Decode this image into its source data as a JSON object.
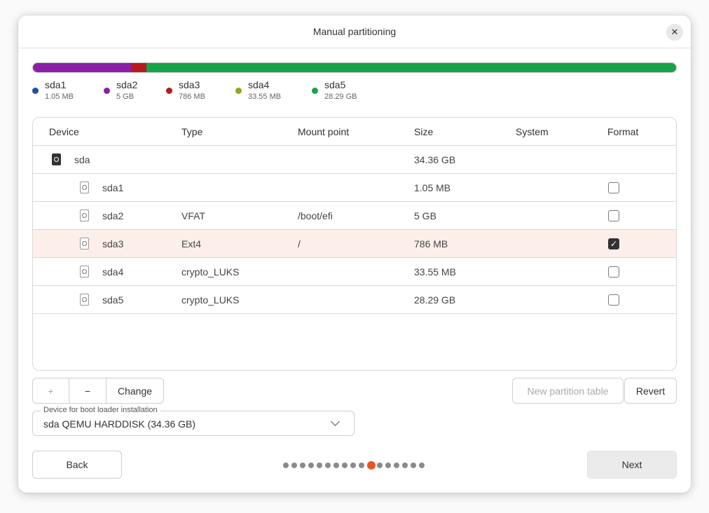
{
  "window": {
    "title": "Manual partitioning",
    "close_icon": "close-icon"
  },
  "usage_bar": [
    {
      "name": "sda1",
      "fraction": 3e-05,
      "color": "#1f4fa5"
    },
    {
      "name": "sda2",
      "fraction": 0.152,
      "color": "#8a1fa8"
    },
    {
      "name": "sda3",
      "fraction": 0.024,
      "color": "#b71c1c"
    },
    {
      "name": "sda4",
      "fraction": 0.001,
      "color": "#8fa81f"
    },
    {
      "name": "sda5",
      "fraction": 0.823,
      "color": "#16a34a"
    }
  ],
  "legend": [
    {
      "name": "sda1",
      "size": "1.05 MB",
      "color": "#1f4fa5"
    },
    {
      "name": "sda2",
      "size": "5 GB",
      "color": "#8a1fa8"
    },
    {
      "name": "sda3",
      "size": "786 MB",
      "color": "#b71c1c"
    },
    {
      "name": "sda4",
      "size": "33.55 MB",
      "color": "#8fa81f"
    },
    {
      "name": "sda5",
      "size": "28.29 GB",
      "color": "#16a34a"
    }
  ],
  "table": {
    "headers": {
      "device": "Device",
      "type": "Type",
      "mount": "Mount point",
      "size": "Size",
      "system": "System",
      "format": "Format"
    },
    "rows": [
      {
        "device": "sda",
        "type": "",
        "mount": "",
        "size": "34.36 GB",
        "system": "",
        "is_disk": true,
        "format": null,
        "selected": false
      },
      {
        "device": "sda1",
        "type": "",
        "mount": "",
        "size": "1.05 MB",
        "system": "",
        "is_disk": false,
        "format": false,
        "selected": false
      },
      {
        "device": "sda2",
        "type": "VFAT",
        "mount": "/boot/efi",
        "size": "5 GB",
        "system": "",
        "is_disk": false,
        "format": false,
        "selected": false
      },
      {
        "device": "sda3",
        "type": "Ext4",
        "mount": "/",
        "size": "786 MB",
        "system": "",
        "is_disk": false,
        "format": true,
        "selected": true
      },
      {
        "device": "sda4",
        "type": "crypto_LUKS",
        "mount": "",
        "size": "33.55 MB",
        "system": "",
        "is_disk": false,
        "format": false,
        "selected": false
      },
      {
        "device": "sda5",
        "type": "crypto_LUKS",
        "mount": "",
        "size": "28.29 GB",
        "system": "",
        "is_disk": false,
        "format": false,
        "selected": false
      }
    ]
  },
  "toolbar": {
    "add_label": "+",
    "remove_label": "−",
    "change_label": "Change",
    "new_table_label": "New partition table",
    "revert_label": "Revert"
  },
  "bootloader": {
    "label": "Device for boot loader installation",
    "value": "sda QEMU HARDDISK (34.36 GB)"
  },
  "footer": {
    "back_label": "Back",
    "next_label": "Next",
    "pager_total": 17,
    "pager_active": 10,
    "pager_active_color": "#e95420"
  }
}
